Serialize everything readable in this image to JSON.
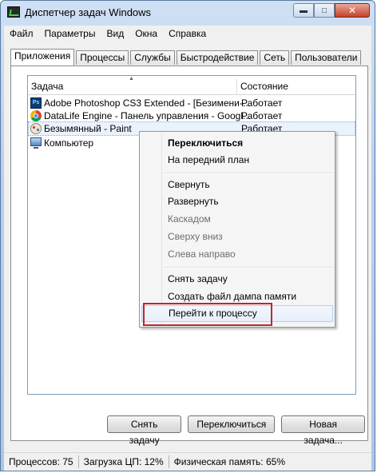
{
  "window": {
    "title": "Диспетчер задач Windows"
  },
  "caption": {
    "minimize": "▬",
    "maximize": "□",
    "close": "✕"
  },
  "menu": [
    "Файл",
    "Параметры",
    "Вид",
    "Окна",
    "Справка"
  ],
  "tabs": [
    "Приложения",
    "Процессы",
    "Службы",
    "Быстродействие",
    "Сеть",
    "Пользователи"
  ],
  "list": {
    "columns": {
      "task": "Задача",
      "state": "Состояние"
    },
    "rows": [
      {
        "name": "Adobe Photoshop CS3 Extended - [Безимени-...",
        "status": "Работает",
        "icon": "photoshop-icon",
        "icon_text": "Ps"
      },
      {
        "name": "DataLife Engine - Панель управления - Googl...",
        "status": "Работает",
        "icon": "chrome-icon"
      },
      {
        "name": "Безымянный - Paint",
        "status": "Работает",
        "icon": "paint-icon"
      },
      {
        "name": "Компьютер",
        "status": "",
        "icon": "computer-icon"
      }
    ]
  },
  "context_menu": [
    {
      "label": "Переключиться",
      "bold": true
    },
    {
      "label": "На передний план"
    },
    {
      "label": "Свернуть"
    },
    {
      "label": "Развернуть"
    },
    {
      "label": "Каскадом",
      "disabled": true
    },
    {
      "label": "Сверху вниз",
      "disabled": true
    },
    {
      "label": "Слева направо",
      "disabled": true
    },
    {
      "label": "Снять задачу"
    },
    {
      "label": "Создать файл дампа памяти"
    },
    {
      "label": "Перейти к процессу",
      "hover": true
    }
  ],
  "buttons": {
    "end_task": "Снять задачу",
    "switch_to": "Переключиться",
    "new_task": "Новая задача..."
  },
  "status": {
    "processes": "Процессов: 75",
    "cpu": "Загрузка ЦП: 12%",
    "memory": "Физическая память: 65%"
  },
  "colors": {
    "highlight_box": "#c0262c",
    "title_gradient": "#b9d1ee"
  }
}
